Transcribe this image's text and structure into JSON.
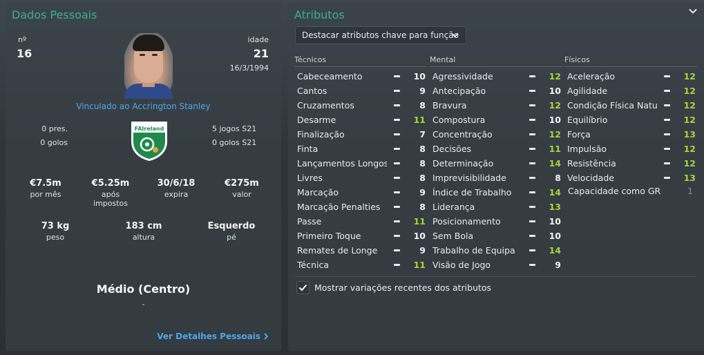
{
  "personal": {
    "title": "Dados Pessoais",
    "number_label": "nº",
    "number": "16",
    "age_label": "idade",
    "age": "21",
    "dob": "16/3/1994",
    "club_link": "Vinculado ao Accrington Stanley",
    "apps_left": "0 pres.",
    "goals_left": "0 golos",
    "apps_right": "5 jogos S21",
    "goals_right": "0 golos S21",
    "crest_text": "FAIreland",
    "finance": [
      {
        "value": "€7.5m",
        "label": "por mês"
      },
      {
        "value": "€5.25m",
        "label": "após impostos"
      },
      {
        "value": "30/6/18",
        "label": "expira"
      },
      {
        "value": "€275m",
        "label": "valor"
      }
    ],
    "physical": [
      {
        "value": "73 kg",
        "label": "peso"
      },
      {
        "value": "183 cm",
        "label": "altura"
      },
      {
        "value": "Esquerdo",
        "label": "pé"
      }
    ],
    "position": "Médio (Centro)",
    "position_sub": "-",
    "details_link": "Ver Detalhes Pessoais"
  },
  "attributes": {
    "title": "Atributos",
    "dropdown_label": "Destacar atributos chave para função",
    "headers": {
      "technical": "Técnicos",
      "mental": "Mental",
      "physical": "Físicos"
    },
    "technical": [
      {
        "name": "Cabeceamento",
        "value": "10",
        "hl": false
      },
      {
        "name": "Cantos",
        "value": "9",
        "hl": false
      },
      {
        "name": "Cruzamentos",
        "value": "8",
        "hl": false
      },
      {
        "name": "Desarme",
        "value": "11",
        "hl": true
      },
      {
        "name": "Finalização",
        "value": "7",
        "hl": false
      },
      {
        "name": "Finta",
        "value": "8",
        "hl": false
      },
      {
        "name": "Lançamentos Longos",
        "value": "8",
        "hl": false
      },
      {
        "name": "Livres",
        "value": "8",
        "hl": false
      },
      {
        "name": "Marcação",
        "value": "9",
        "hl": false
      },
      {
        "name": "Marcação Penalties",
        "value": "8",
        "hl": false
      },
      {
        "name": "Passe",
        "value": "11",
        "hl": true
      },
      {
        "name": "Primeiro Toque",
        "value": "10",
        "hl": false
      },
      {
        "name": "Remates de Longe",
        "value": "9",
        "hl": false
      },
      {
        "name": "Técnica",
        "value": "11",
        "hl": true
      }
    ],
    "mental": [
      {
        "name": "Agressividade",
        "value": "12",
        "hl": true
      },
      {
        "name": "Antecipação",
        "value": "10",
        "hl": false
      },
      {
        "name": "Bravura",
        "value": "12",
        "hl": true
      },
      {
        "name": "Compostura",
        "value": "10",
        "hl": false
      },
      {
        "name": "Concentração",
        "value": "12",
        "hl": true
      },
      {
        "name": "Decisões",
        "value": "11",
        "hl": true
      },
      {
        "name": "Determinação",
        "value": "14",
        "hl": true
      },
      {
        "name": "Imprevisibilidade",
        "value": "8",
        "hl": false
      },
      {
        "name": "Índice de Trabalho",
        "value": "14",
        "hl": true
      },
      {
        "name": "Liderança",
        "value": "13",
        "hl": true
      },
      {
        "name": "Posicionamento",
        "value": "10",
        "hl": false
      },
      {
        "name": "Sem Bola",
        "value": "10",
        "hl": false
      },
      {
        "name": "Trabalho de Equipa",
        "value": "14",
        "hl": true
      },
      {
        "name": "Visão de Jogo",
        "value": "9",
        "hl": false
      }
    ],
    "physical": [
      {
        "name": "Aceleração",
        "value": "12",
        "hl": true
      },
      {
        "name": "Agilidade",
        "value": "12",
        "hl": true
      },
      {
        "name": "Condição Física Natu...",
        "value": "12",
        "hl": true
      },
      {
        "name": "Equilíbrio",
        "value": "12",
        "hl": true
      },
      {
        "name": "Força",
        "value": "13",
        "hl": true
      },
      {
        "name": "Impulsão",
        "value": "12",
        "hl": true
      },
      {
        "name": "Resistência",
        "value": "12",
        "hl": true
      },
      {
        "name": "Velocidade",
        "value": "13",
        "hl": true
      }
    ],
    "gk_label": "Capacidade como GR",
    "gk_value": "1",
    "checkbox_label": "Mostrar variações recentes dos atributos",
    "checkbox_checked": true
  },
  "colors": {
    "accent": "#3bb08b",
    "highlight": "#a9d33b",
    "link": "#4ea7e8"
  },
  "icons": [
    "chevron-down-icon",
    "collapse-chevron-icon",
    "checkmark-icon",
    "chevron-right-icon"
  ]
}
